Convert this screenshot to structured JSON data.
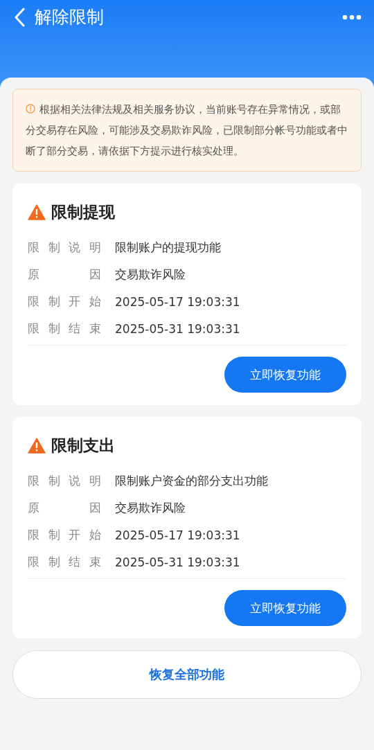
{
  "header": {
    "title": "解除限制"
  },
  "notice": {
    "text": "根据相关法律法规及相关服务协议，当前账号存在异常情况，或部分交易存在风险，可能涉及交易欺诈风险，已限制部分帐号功能或者中断了部分交易，请依据下方提示进行核实处理。"
  },
  "restrictions": [
    {
      "title": "限制提现",
      "rows": [
        {
          "label": "限制说明",
          "value": "限制账户的提现功能"
        },
        {
          "label": "原因",
          "value": "交易欺诈风险"
        },
        {
          "label": "限制开始",
          "value": "2025-05-17 19:03:31"
        },
        {
          "label": "限制结束",
          "value": "2025-05-31 19:03:31"
        }
      ],
      "button": "立即恢复功能"
    },
    {
      "title": "限制支出",
      "rows": [
        {
          "label": "限制说明",
          "value": "限制账户资金的部分支出功能"
        },
        {
          "label": "原因",
          "value": "交易欺诈风险"
        },
        {
          "label": "限制开始",
          "value": "2025-05-17 19:03:31"
        },
        {
          "label": "限制结束",
          "value": "2025-05-31 19:03:31"
        }
      ],
      "button": "立即恢复功能"
    }
  ],
  "restore_all_button": "恢复全部功能"
}
